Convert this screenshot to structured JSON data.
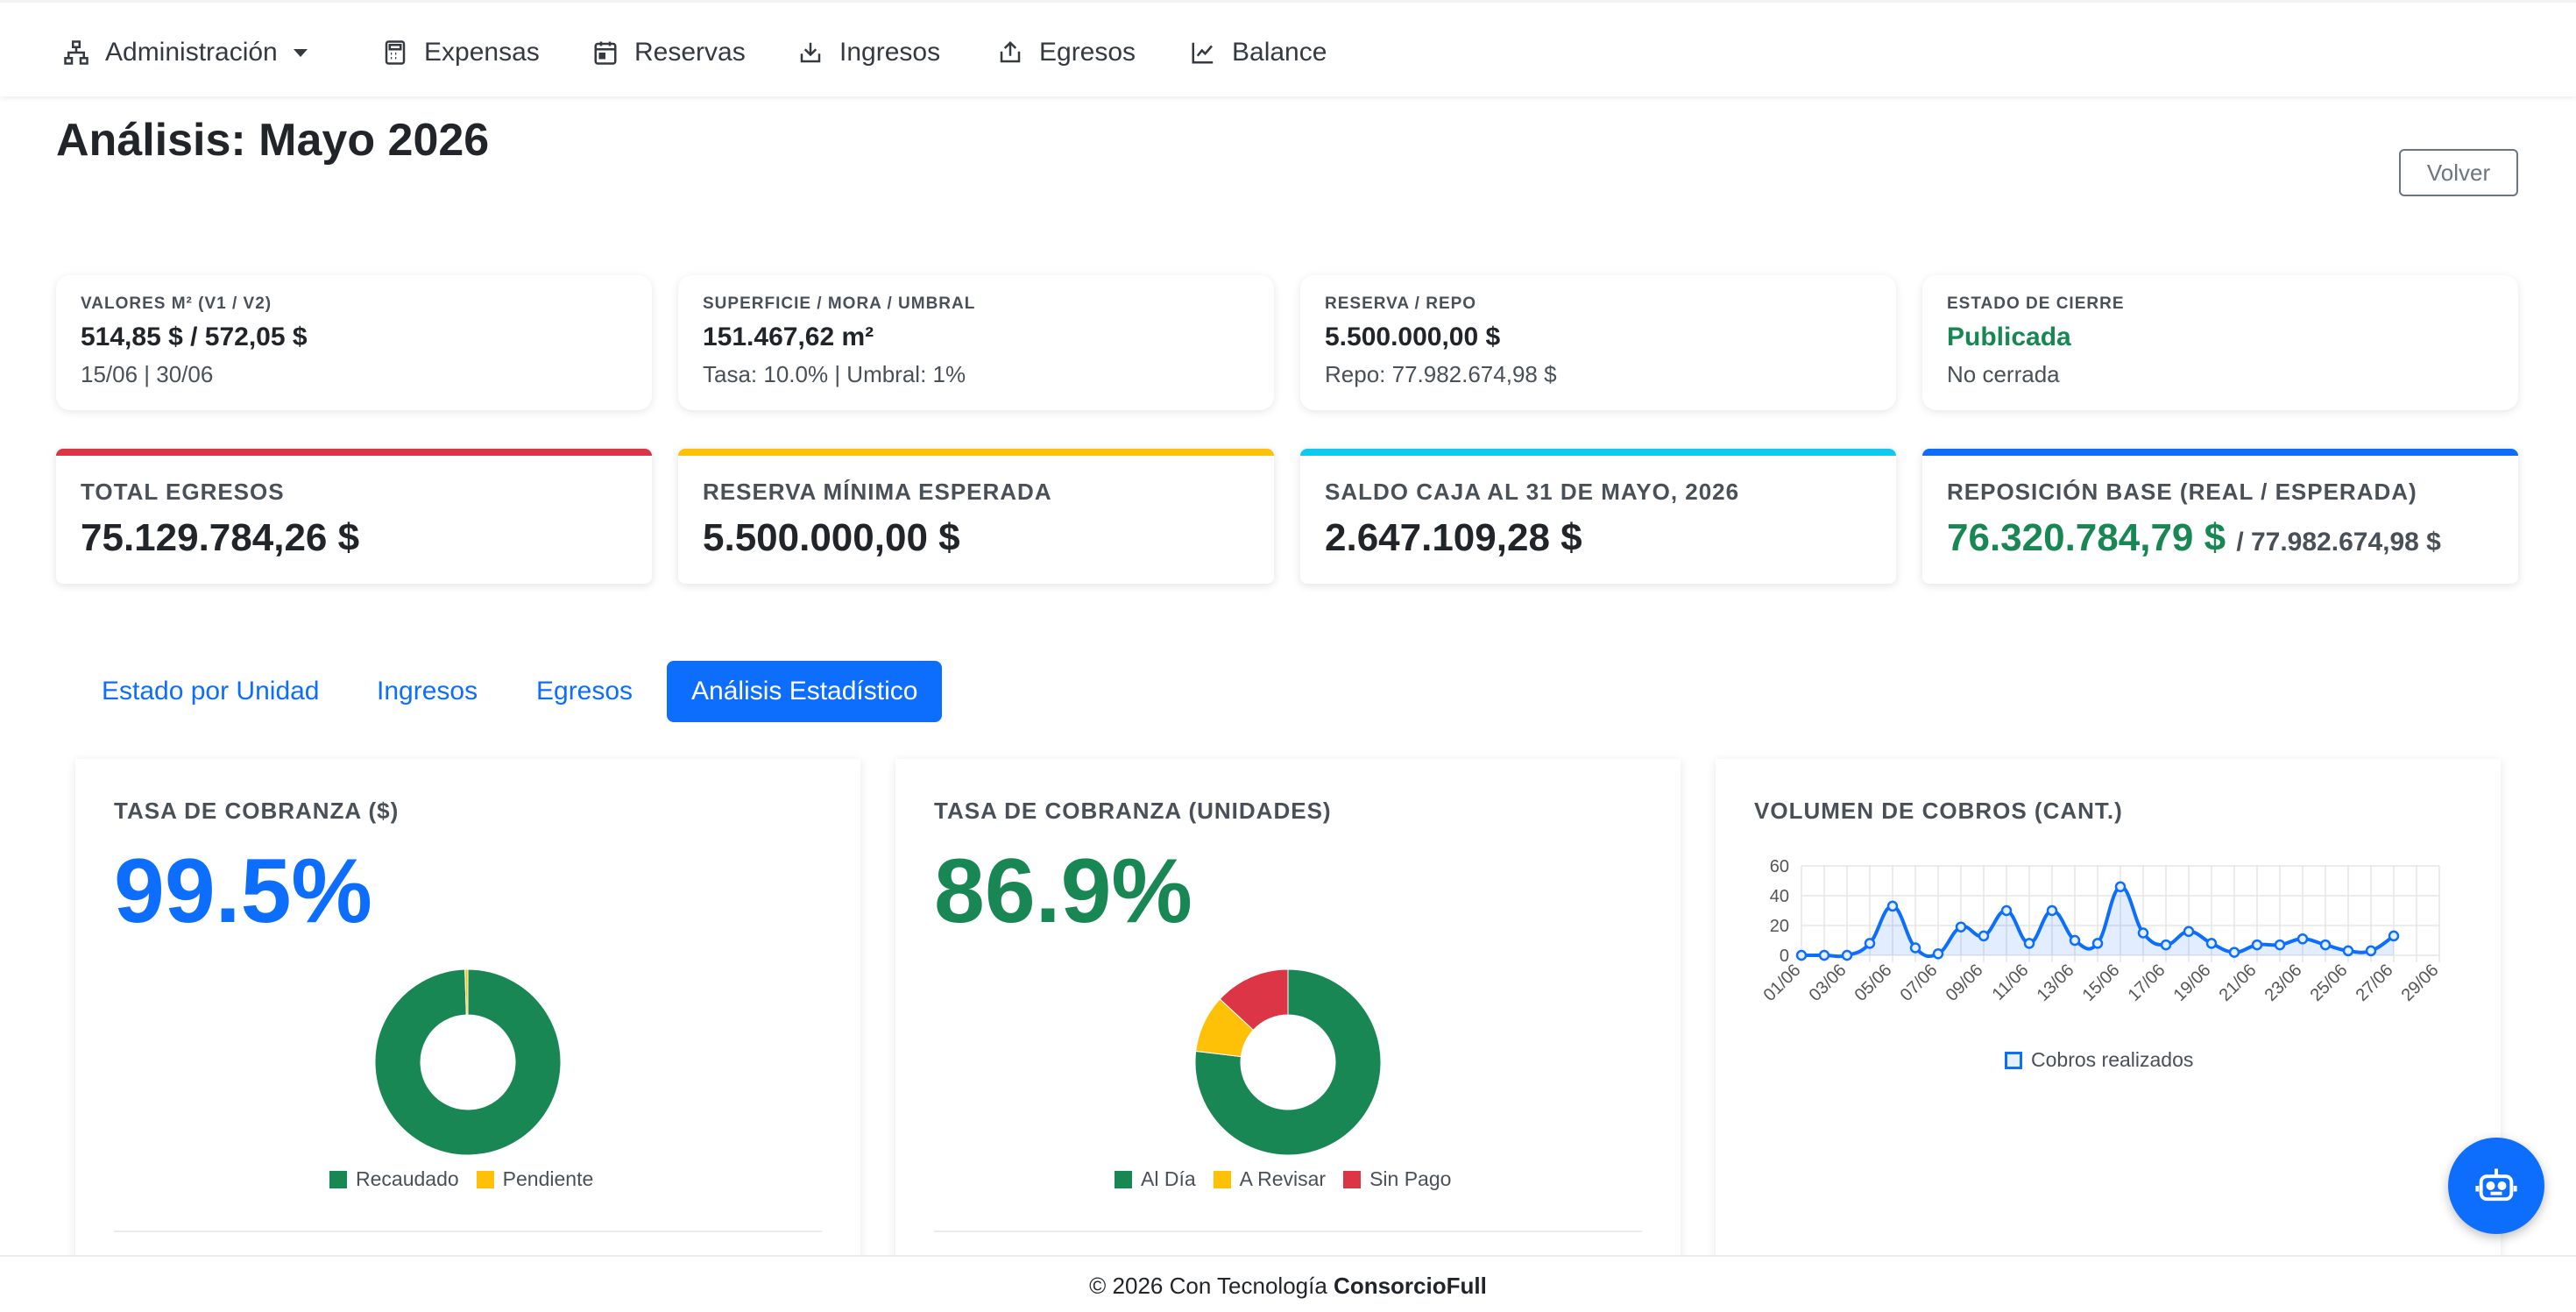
{
  "nav": {
    "items": [
      {
        "label": "Administración",
        "icon": "sitemap-icon"
      },
      {
        "label": "Expensas",
        "icon": "calculator-icon"
      },
      {
        "label": "Reservas",
        "icon": "calendar-icon"
      },
      {
        "label": "Ingresos",
        "icon": "download-icon"
      },
      {
        "label": "Egresos",
        "icon": "upload-icon"
      },
      {
        "label": "Balance",
        "icon": "chart-line-icon"
      }
    ]
  },
  "page": {
    "title": "Análisis: Mayo 2026",
    "back_button": "Volver"
  },
  "info_cards": [
    {
      "label": "VALORES M² (V1 / V2)",
      "value": "514,85 $ / 572,05 $",
      "sub": "15/06 | 30/06"
    },
    {
      "label": "SUPERFICIE / MORA / UMBRAL",
      "value": "151.467,62 m²",
      "sub": "Tasa: 10.0% | Umbral: 1%"
    },
    {
      "label": "RESERVA / REPO",
      "value": "5.500.000,00 $",
      "sub": "Repo: 77.982.674,98 $"
    },
    {
      "label": "ESTADO DE CIERRE",
      "value": "Publicada",
      "sub": "No cerrada"
    }
  ],
  "kpi_cards": [
    {
      "label": "TOTAL EGRESOS",
      "value": "75.129.784,26 $",
      "color": "#dc3545"
    },
    {
      "label": "RESERVA MÍNIMA ESPERADA",
      "value": "5.500.000,00 $",
      "color": "#ffc107"
    },
    {
      "label": "SALDO CAJA AL 31 DE MAYO, 2026",
      "value": "2.647.109,28 $",
      "color": "#0dcaf0"
    },
    {
      "label": "REPOSICIÓN BASE (REAL / ESPERADA)",
      "value": "76.320.784,79 $",
      "value_secondary": "/ 77.982.674,98 $",
      "color": "#0d6efd"
    }
  ],
  "tabs": [
    {
      "label": "Estado por Unidad",
      "active": false
    },
    {
      "label": "Ingresos",
      "active": false
    },
    {
      "label": "Egresos",
      "active": false
    },
    {
      "label": "Análisis Estadístico",
      "active": true
    }
  ],
  "stats": {
    "cobranza_pesos": {
      "label": "TASA DE COBRANZA ($)",
      "value": "99.5%",
      "color": "#0d6efd"
    },
    "cobranza_unidades": {
      "label": "TASA DE COBRANZA (UNIDADES)",
      "value": "86.9%",
      "color": "#198754"
    },
    "volumen": {
      "label": "VOLUMEN DE COBROS (CANT.)"
    }
  },
  "chart_data": [
    {
      "type": "pie",
      "variant": "doughnut",
      "labels": [
        "Recaudado",
        "Pendiente"
      ],
      "values": [
        99.5,
        0.5
      ],
      "colors": [
        "#198754",
        "#ffc107"
      ],
      "legend": "bottom"
    },
    {
      "type": "pie",
      "variant": "doughnut",
      "labels": [
        "Al Día",
        "A Revisar",
        "Sin Pago"
      ],
      "values": [
        76.9,
        10.0,
        13.1
      ],
      "colors": [
        "#198754",
        "#ffc107",
        "#dc3545"
      ],
      "legend": "bottom"
    },
    {
      "type": "line",
      "fill": true,
      "categories": [
        "01/06",
        "02/06",
        "03/06",
        "04/06",
        "05/06",
        "06/06",
        "07/06",
        "08/06",
        "09/06",
        "10/06",
        "11/06",
        "12/06",
        "13/06",
        "14/06",
        "15/06",
        "16/06",
        "17/06",
        "18/06",
        "19/06",
        "20/06",
        "21/06",
        "22/06",
        "23/06",
        "24/06",
        "25/06",
        "26/06",
        "27/06",
        "28/06",
        "29/06"
      ],
      "tick_labels": [
        "01/06",
        "03/06",
        "05/06",
        "07/06",
        "09/06",
        "11/06",
        "13/06",
        "15/06",
        "17/06",
        "19/06",
        "21/06",
        "23/06",
        "25/06",
        "27/06",
        "29/06"
      ],
      "series": [
        {
          "name": "Cobros realizados",
          "color": "#0d6efd",
          "values": [
            0,
            0,
            0,
            8,
            33,
            5,
            1,
            19,
            13,
            30,
            8,
            30,
            10,
            8,
            46,
            15,
            7,
            16,
            8,
            2,
            7,
            7,
            11,
            7,
            3,
            3,
            13
          ]
        }
      ],
      "ylim": [
        0,
        60
      ],
      "yticks": [
        0,
        20,
        40,
        60
      ],
      "grid": true,
      "legend": "bottom"
    }
  ],
  "footer": {
    "prefix": "© 2026 Con Tecnología ",
    "brand": "ConsorcioFull"
  },
  "fab": {
    "icon": "robot-icon"
  }
}
